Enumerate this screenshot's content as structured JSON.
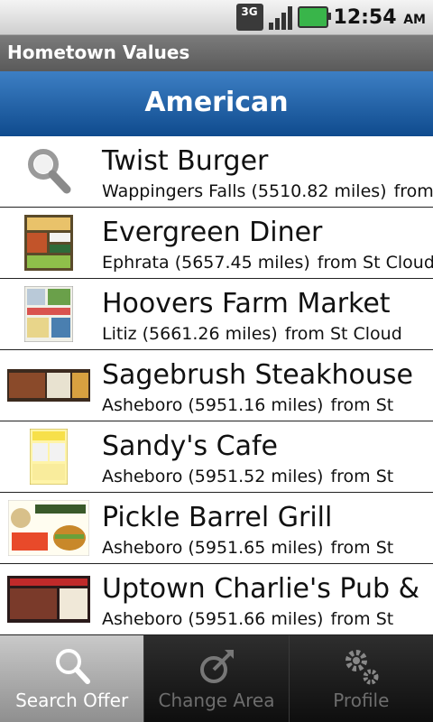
{
  "status": {
    "network": "3G",
    "time": "12:54",
    "ampm": "AM",
    "battery_color": "#39b54a"
  },
  "app": {
    "title": "Hometown Values"
  },
  "category": {
    "title": "American"
  },
  "offers": [
    {
      "name": "Twist Burger",
      "distance": "Wappingers Falls (5510.82 miles)",
      "from": "from",
      "thumb": "search-placeholder"
    },
    {
      "name": "Evergreen Diner",
      "distance": "Ephrata (5657.45 miles)",
      "from": "from St Cloud",
      "thumb": "coupon"
    },
    {
      "name": "Hoovers Farm Market",
      "distance": "Litiz (5661.26 miles)",
      "from": "from St Cloud",
      "thumb": "coupon"
    },
    {
      "name": "Sagebrush Steakhouse",
      "distance": "Asheboro (5951.16 miles)",
      "from": "from St",
      "thumb": "coupon"
    },
    {
      "name": "Sandy's Cafe",
      "distance": "Asheboro (5951.52 miles)",
      "from": "from St",
      "thumb": "coupon"
    },
    {
      "name": "Pickle Barrel Grill",
      "distance": "Asheboro (5951.65 miles)",
      "from": "from St",
      "thumb": "coupon"
    },
    {
      "name": "Uptown Charlie's Pub &",
      "distance": "Asheboro (5951.66 miles)",
      "from": "from St",
      "thumb": "coupon"
    }
  ],
  "tabs": [
    {
      "label": "Search Offer",
      "icon": "search-icon",
      "active": true
    },
    {
      "label": "Change Area",
      "icon": "compass-icon",
      "active": false
    },
    {
      "label": "Profile",
      "icon": "gear-icon",
      "active": false
    }
  ]
}
